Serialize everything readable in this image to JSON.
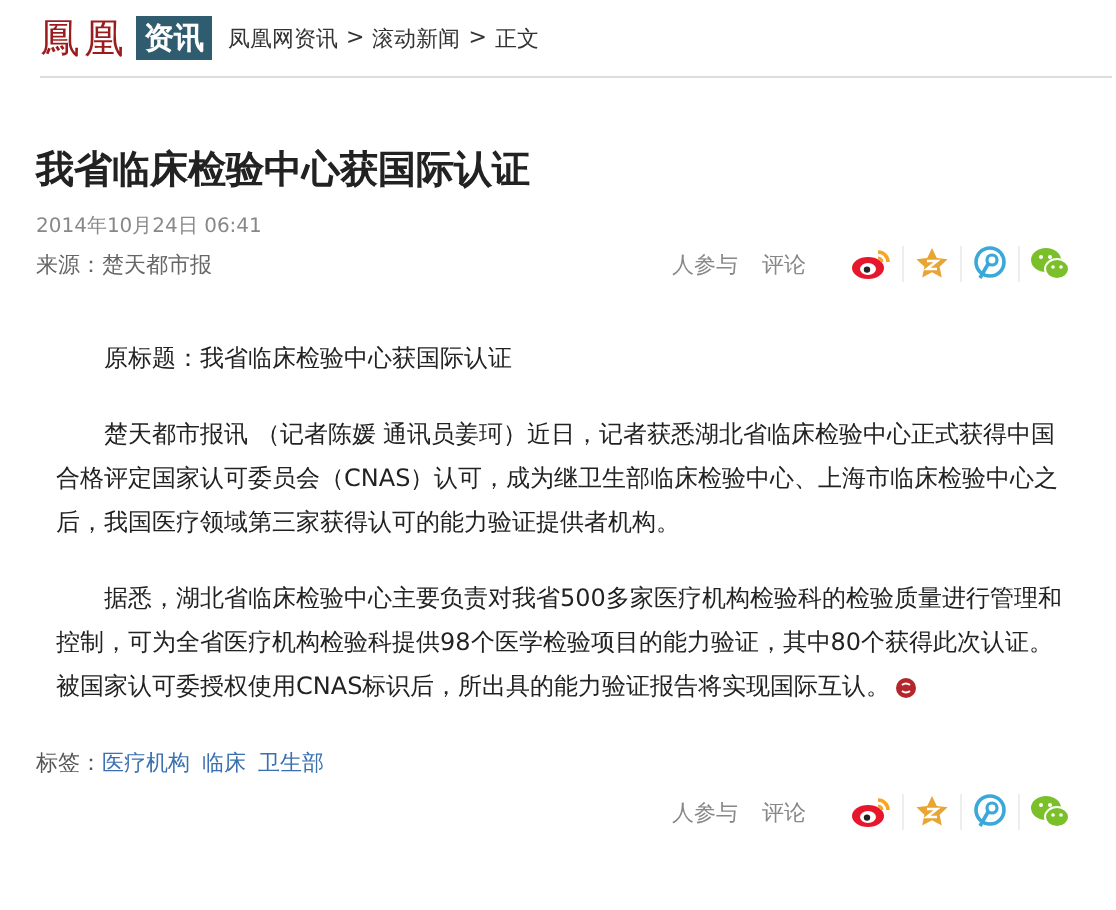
{
  "header": {
    "logo": "鳳凰",
    "channel": "资讯",
    "breadcrumb": [
      {
        "label": "凤凰网资讯"
      },
      {
        "label": ">"
      },
      {
        "label": "滚动新闻"
      },
      {
        "label": ">"
      },
      {
        "label": "正文"
      }
    ]
  },
  "article": {
    "title": "我省临床检验中心获国际认证",
    "date": "2014年10月24日 06:41",
    "source": "来源：楚天都市报",
    "paragraphs": [
      "原标题：我省临床检验中心获国际认证",
      "楚天都市报讯 （记者陈媛 通讯员姜珂）近日，记者获悉湖北省临床检验中心正式获得中国合格评定国家认可委员会（CNAS）认可，成为继卫生部临床检验中心、上海市临床检验中心之后，我国医疗领域第三家获得认可的能力验证提供者机构。",
      "据悉，湖北省临床检验中心主要负责对我省500多家医疗机构检验科的检验质量进行管理和控制，可为全省医疗机构检验科提供98个医学检验项目的能力验证，其中80个获得此次认证。被国家认可委授权使用CNAS标识后，所出具的能力验证报告将实现国际互认。"
    ]
  },
  "share_top": {
    "participants": "人参与",
    "comments": "评论"
  },
  "tags": {
    "label": "标签：",
    "items": [
      "医疗机构",
      "临床",
      "卫生部"
    ]
  },
  "share_bottom": {
    "participants": "人参与",
    "comments": "评论"
  }
}
